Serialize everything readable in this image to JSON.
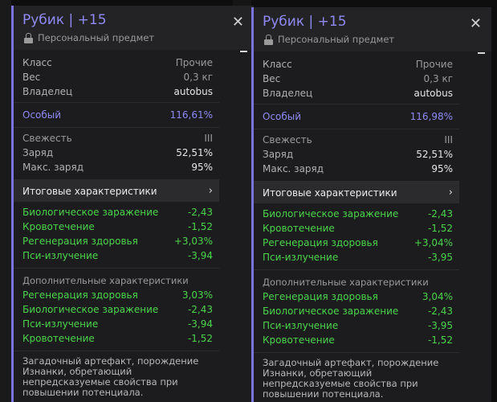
{
  "tooltips": [
    {
      "title": "Рубик | +15",
      "subtitle": "Персональный предмет",
      "props": [
        {
          "label": "Класс",
          "value": "Прочие",
          "vc": "muted"
        },
        {
          "label": "Вес",
          "value": "0,3 кг",
          "vc": "muted"
        },
        {
          "label": "Владелец",
          "value": "autobus",
          "vc": "v"
        }
      ],
      "special": {
        "label": "Особый",
        "value": "116,61%"
      },
      "state": [
        {
          "label": "Свежесть",
          "value": "III",
          "lc": "muted",
          "vc": "muted"
        },
        {
          "label": "Заряд",
          "value": "52,51%",
          "lc": "lbl",
          "vc": "v"
        },
        {
          "label": "Макс. заряд",
          "value": "95%",
          "lc": "lbl",
          "vc": "v"
        }
      ],
      "summary_label": "Итоговые характеристики",
      "totals": [
        {
          "label": "Биологическое заражение",
          "value": "-2,43"
        },
        {
          "label": "Кровотечение",
          "value": "-1,52"
        },
        {
          "label": "Регенерация здоровья",
          "value": "+3,03%"
        },
        {
          "label": "Пси-излучение",
          "value": "-3,94"
        }
      ],
      "extra_heading": "Дополнительные характеристики",
      "extras": [
        {
          "label": "Регенерация здоровья",
          "value": "3,03%"
        },
        {
          "label": "Биологическое заражение",
          "value": "-2,43"
        },
        {
          "label": "Пси-излучение",
          "value": "-3,94"
        },
        {
          "label": "Кровотечение",
          "value": "-1,52"
        }
      ],
      "description": "Загадочный артефакт, порождение Изнанки, обретающий непредсказуемые свойства при повышении потенциала."
    },
    {
      "title": "Рубик | +15",
      "subtitle": "Персональный предмет",
      "props": [
        {
          "label": "Класс",
          "value": "Прочие",
          "vc": "muted"
        },
        {
          "label": "Вес",
          "value": "0,3 кг",
          "vc": "muted"
        },
        {
          "label": "Владелец",
          "value": "autobus",
          "vc": "v"
        }
      ],
      "special": {
        "label": "Особый",
        "value": "116,98%"
      },
      "state": [
        {
          "label": "Свежесть",
          "value": "III",
          "lc": "muted",
          "vc": "muted"
        },
        {
          "label": "Заряд",
          "value": "52,51%",
          "lc": "lbl",
          "vc": "v"
        },
        {
          "label": "Макс. заряд",
          "value": "95%",
          "lc": "lbl",
          "vc": "v"
        }
      ],
      "summary_label": "Итоговые характеристики",
      "totals": [
        {
          "label": "Биологическое заражение",
          "value": "-2,43"
        },
        {
          "label": "Кровотечение",
          "value": "-1,52"
        },
        {
          "label": "Регенерация здоровья",
          "value": "+3,04%"
        },
        {
          "label": "Пси-излучение",
          "value": "-3,95"
        }
      ],
      "extra_heading": "Дополнительные характеристики",
      "extras": [
        {
          "label": "Регенерация здоровья",
          "value": "3,04%"
        },
        {
          "label": "Биологическое заражение",
          "value": "-2,43"
        },
        {
          "label": "Пси-излучение",
          "value": "-3,95"
        },
        {
          "label": "Кровотечение",
          "value": "-1,52"
        }
      ],
      "description": "Загадочный артефакт, порождение Изнанки, обретающий непредсказуемые свойства при повышении потенциала."
    }
  ],
  "accent_color": "#8f8af5",
  "positive_color": "#4bd44b"
}
